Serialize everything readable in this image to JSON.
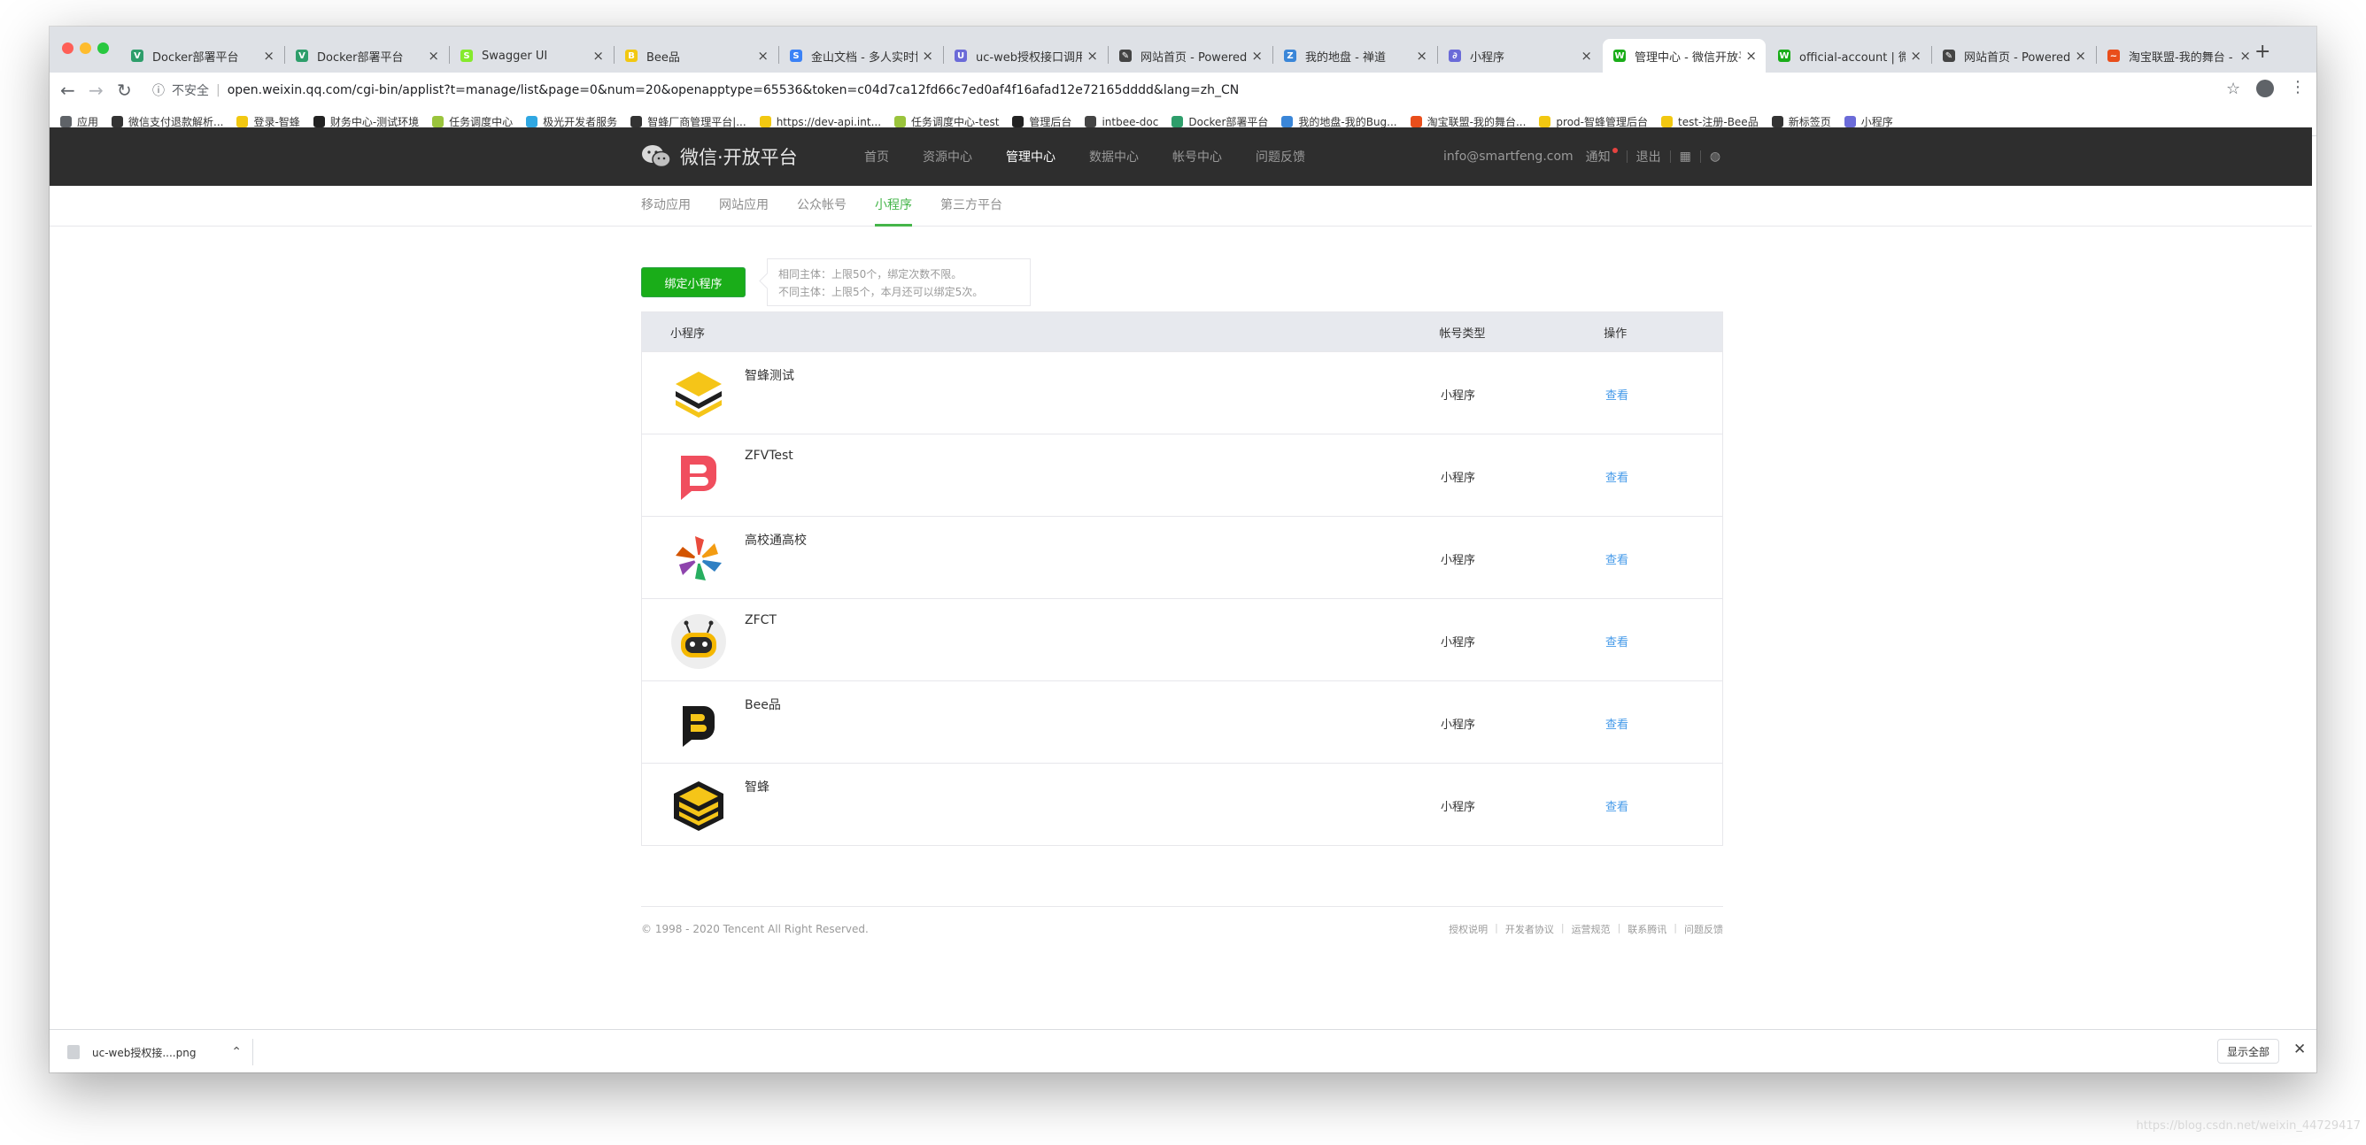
{
  "browser": {
    "tabs": [
      {
        "title": "Docker部署平台",
        "color": "#2e9e6b",
        "glyph": "V"
      },
      {
        "title": "Docker部署平台",
        "color": "#2e9e6b",
        "glyph": "V"
      },
      {
        "title": "Swagger UI",
        "color": "#85ea2d",
        "glyph": "S"
      },
      {
        "title": "Bee品",
        "color": "#f2c811",
        "glyph": "B"
      },
      {
        "title": "金山文档 - 多人实时协",
        "color": "#3b82f6",
        "glyph": "S"
      },
      {
        "title": "uc-web授权接口调用",
        "color": "#6b6bd8",
        "glyph": "U"
      },
      {
        "title": "网站首页 - Powered by",
        "color": "#444444",
        "glyph": "✎"
      },
      {
        "title": "我的地盘 - 禅道",
        "color": "#3a86d8",
        "glyph": "Z"
      },
      {
        "title": "小程序",
        "color": "#6b6bd8",
        "glyph": "∂"
      },
      {
        "title": "管理中心 - 微信开放平",
        "color": "#1aad19",
        "glyph": "W"
      },
      {
        "title": "official-account | 微信",
        "color": "#1aad19",
        "glyph": "W"
      },
      {
        "title": "网站首页 - Powered by",
        "color": "#444444",
        "glyph": "✎"
      },
      {
        "title": "淘宝联盟-我的舞台 -",
        "color": "#e94e1b",
        "glyph": "~"
      }
    ],
    "active_tab_index": 9,
    "url_insecure_label": "不安全",
    "url": "open.weixin.qq.com/cgi-bin/applist?t=manage/list&page=0&num=20&openapptype=65536&token=c04d7ca12fd66c7ed0af4f16afad12e72165dddd&lang=zh_CN",
    "bookmarks": [
      {
        "label": "应用",
        "color": "#5f6368"
      },
      {
        "label": "微信支付退款解析...",
        "color": "#333333"
      },
      {
        "label": "登录-智蜂",
        "color": "#f2c811"
      },
      {
        "label": "财务中心-测试环境",
        "color": "#222222"
      },
      {
        "label": "任务调度中心",
        "color": "#9ac43c"
      },
      {
        "label": "极光开发者服务",
        "color": "#2fa7e2"
      },
      {
        "label": "智蜂厂商管理平台|...",
        "color": "#333333"
      },
      {
        "label": "https://dev-api.int...",
        "color": "#f2c811"
      },
      {
        "label": "任务调度中心-test",
        "color": "#9ac43c"
      },
      {
        "label": "管理后台",
        "color": "#222222"
      },
      {
        "label": "intbee-doc",
        "color": "#444444"
      },
      {
        "label": "Docker部署平台",
        "color": "#2e9e6b"
      },
      {
        "label": "我的地盘-我的Bug...",
        "color": "#3a86d8"
      },
      {
        "label": "淘宝联盟-我的舞台...",
        "color": "#e94e1b"
      },
      {
        "label": "prod-智蜂管理后台",
        "color": "#f2c811"
      },
      {
        "label": "test-注册-Bee品",
        "color": "#f2c811"
      },
      {
        "label": "新标签页",
        "color": "#333333"
      },
      {
        "label": "小程序",
        "color": "#6b6bd8"
      }
    ]
  },
  "header": {
    "logo_text": "微信·开放平台",
    "nav": [
      "首页",
      "资源中心",
      "管理中心",
      "数据中心",
      "帐号中心",
      "问题反馈"
    ],
    "nav_current_index": 2,
    "email": "info@smartfeng.com",
    "notice": "通知",
    "logout": "退出"
  },
  "subnav": {
    "items": [
      "移动应用",
      "网站应用",
      "公众帐号",
      "小程序",
      "第三方平台"
    ],
    "current_index": 3
  },
  "bind": {
    "button_label": "绑定小程序",
    "tip_line1": "相同主体：上限50个，绑定次数不限。",
    "tip_line2": "不同主体：上限5个，本月还可以绑定5次。"
  },
  "table": {
    "headers": {
      "name": "小程序",
      "type": "帐号类型",
      "op": "操作"
    },
    "rows": [
      {
        "name": "智蜂测试",
        "type": "小程序",
        "op": "查看",
        "logo": "stack-icon"
      },
      {
        "name": "ZFVTest",
        "type": "小程序",
        "op": "查看",
        "logo": "b-red-icon"
      },
      {
        "name": "高校通高校",
        "type": "小程序",
        "op": "查看",
        "logo": "pinwheel-icon"
      },
      {
        "name": "ZFCT",
        "type": "小程序",
        "op": "查看",
        "logo": "robot-icon"
      },
      {
        "name": "Bee品",
        "type": "小程序",
        "op": "查看",
        "logo": "b-yellow-icon"
      },
      {
        "name": "智蜂",
        "type": "小程序",
        "op": "查看",
        "logo": "stack-cube-icon"
      }
    ]
  },
  "footer": {
    "copyright": "© 1998 - 2020 Tencent All Right Reserved.",
    "links": [
      "授权说明",
      "开发者协议",
      "运营规范",
      "联系腾讯",
      "问题反馈"
    ]
  },
  "download_shelf": {
    "file_name": "uc-web授权接....png",
    "show_all": "显示全部"
  },
  "watermark": "https://blog.csdn.net/weixin_44729417",
  "colors": {
    "header_bg": "#2e2e2e",
    "accent_green": "#44b549",
    "button_green": "#1aad19",
    "link_blue": "#459ae9"
  }
}
